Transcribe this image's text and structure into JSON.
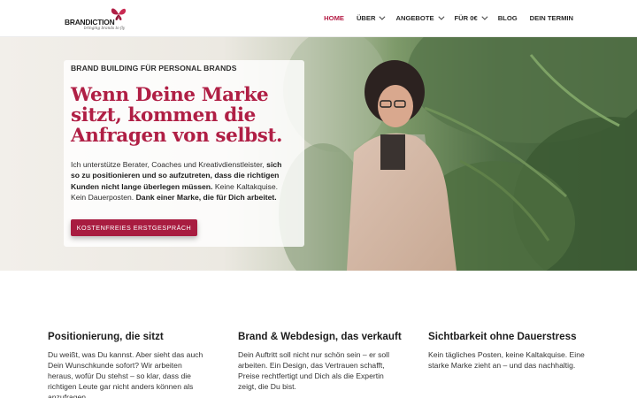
{
  "brand": {
    "name": "BRANDICTION",
    "tagline": "bringing brands to fly",
    "logo_icon": "butterfly-icon",
    "accent_color": "#b01f45"
  },
  "nav": {
    "items": [
      {
        "label": "HOME",
        "active": true,
        "has_dropdown": false
      },
      {
        "label": "ÜBER",
        "active": false,
        "has_dropdown": true
      },
      {
        "label": "ANGEBOTE",
        "active": false,
        "has_dropdown": true
      },
      {
        "label": "FÜR 0€",
        "active": false,
        "has_dropdown": true
      },
      {
        "label": "BLOG",
        "active": false,
        "has_dropdown": false
      },
      {
        "label": "DEIN TERMIN",
        "active": false,
        "has_dropdown": false
      }
    ]
  },
  "hero": {
    "eyebrow": "BRAND BUILDING FÜR PERSONAL BRANDS",
    "headline": "Wenn Deine Marke sitzt, kommen die Anfragen von selbst.",
    "body_1": "Ich unterstütze Berater, Coaches und Kreativdienstleister, ",
    "body_2": "sich so zu positionieren und so aufzutreten, dass die richtigen Kunden nicht lange überlegen müssen.",
    "body_3": " Keine Kaltakquise. Kein Dauerposten. ",
    "body_4": "Dank einer Marke, die für Dich arbeitet.",
    "cta_label": "KOSTENFREIES ERSTGESPRÄCH"
  },
  "features": [
    {
      "title": "Positionierung, die sitzt",
      "text": "Du weißt, was Du kannst. Aber sieht das auch Dein Wunschkunde sofort? Wir arbeiten heraus, wofür Du stehst – so klar, dass die richtigen Leute gar nicht anders können als anzufragen."
    },
    {
      "title": "Brand & Webdesign, das verkauft",
      "text": "Dein Auftritt soll nicht nur schön sein – er soll arbeiten. Ein Design, das Vertrauen schafft, Preise rechtfertigt und Dich als die Expertin zeigt, die Du bist."
    },
    {
      "title": "Sichtbarkeit ohne Dauerstress",
      "text": "Kein tägliches Posten, keine Kaltakquise. Eine starke Marke zieht an – und das nachhaltig."
    }
  ]
}
